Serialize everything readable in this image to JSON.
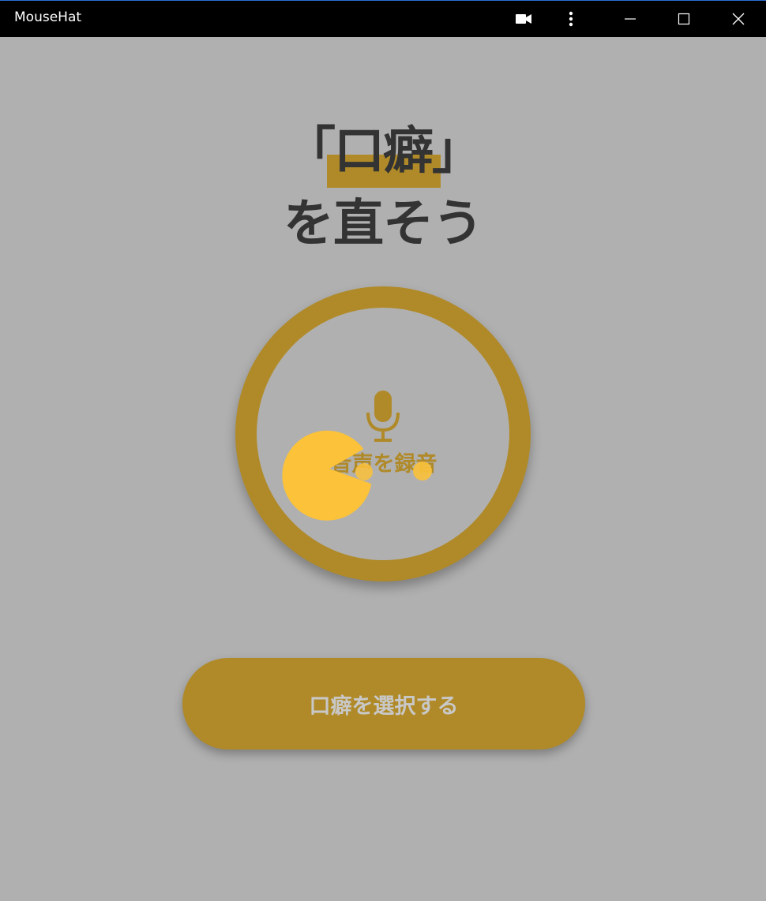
{
  "window": {
    "title": "MouseHat",
    "icons": [
      "video-camera-icon",
      "more-vertical-icon",
      "minimize-icon",
      "maximize-icon",
      "close-icon"
    ]
  },
  "headline": {
    "line1_open": "「",
    "line1_word": "口癖",
    "line1_close": "」",
    "line2": "を直そう"
  },
  "record": {
    "label": "音声を録音",
    "icon": "microphone-icon"
  },
  "select_button": {
    "label": "口癖を選択する"
  },
  "overlay": {
    "icon": "pacman-cursor-icon"
  },
  "colors": {
    "background": "#b0b0b0",
    "accent": "#b08a28",
    "headline_text": "#333333",
    "pacman": "#fbc23a",
    "titlebar": "#000000"
  }
}
